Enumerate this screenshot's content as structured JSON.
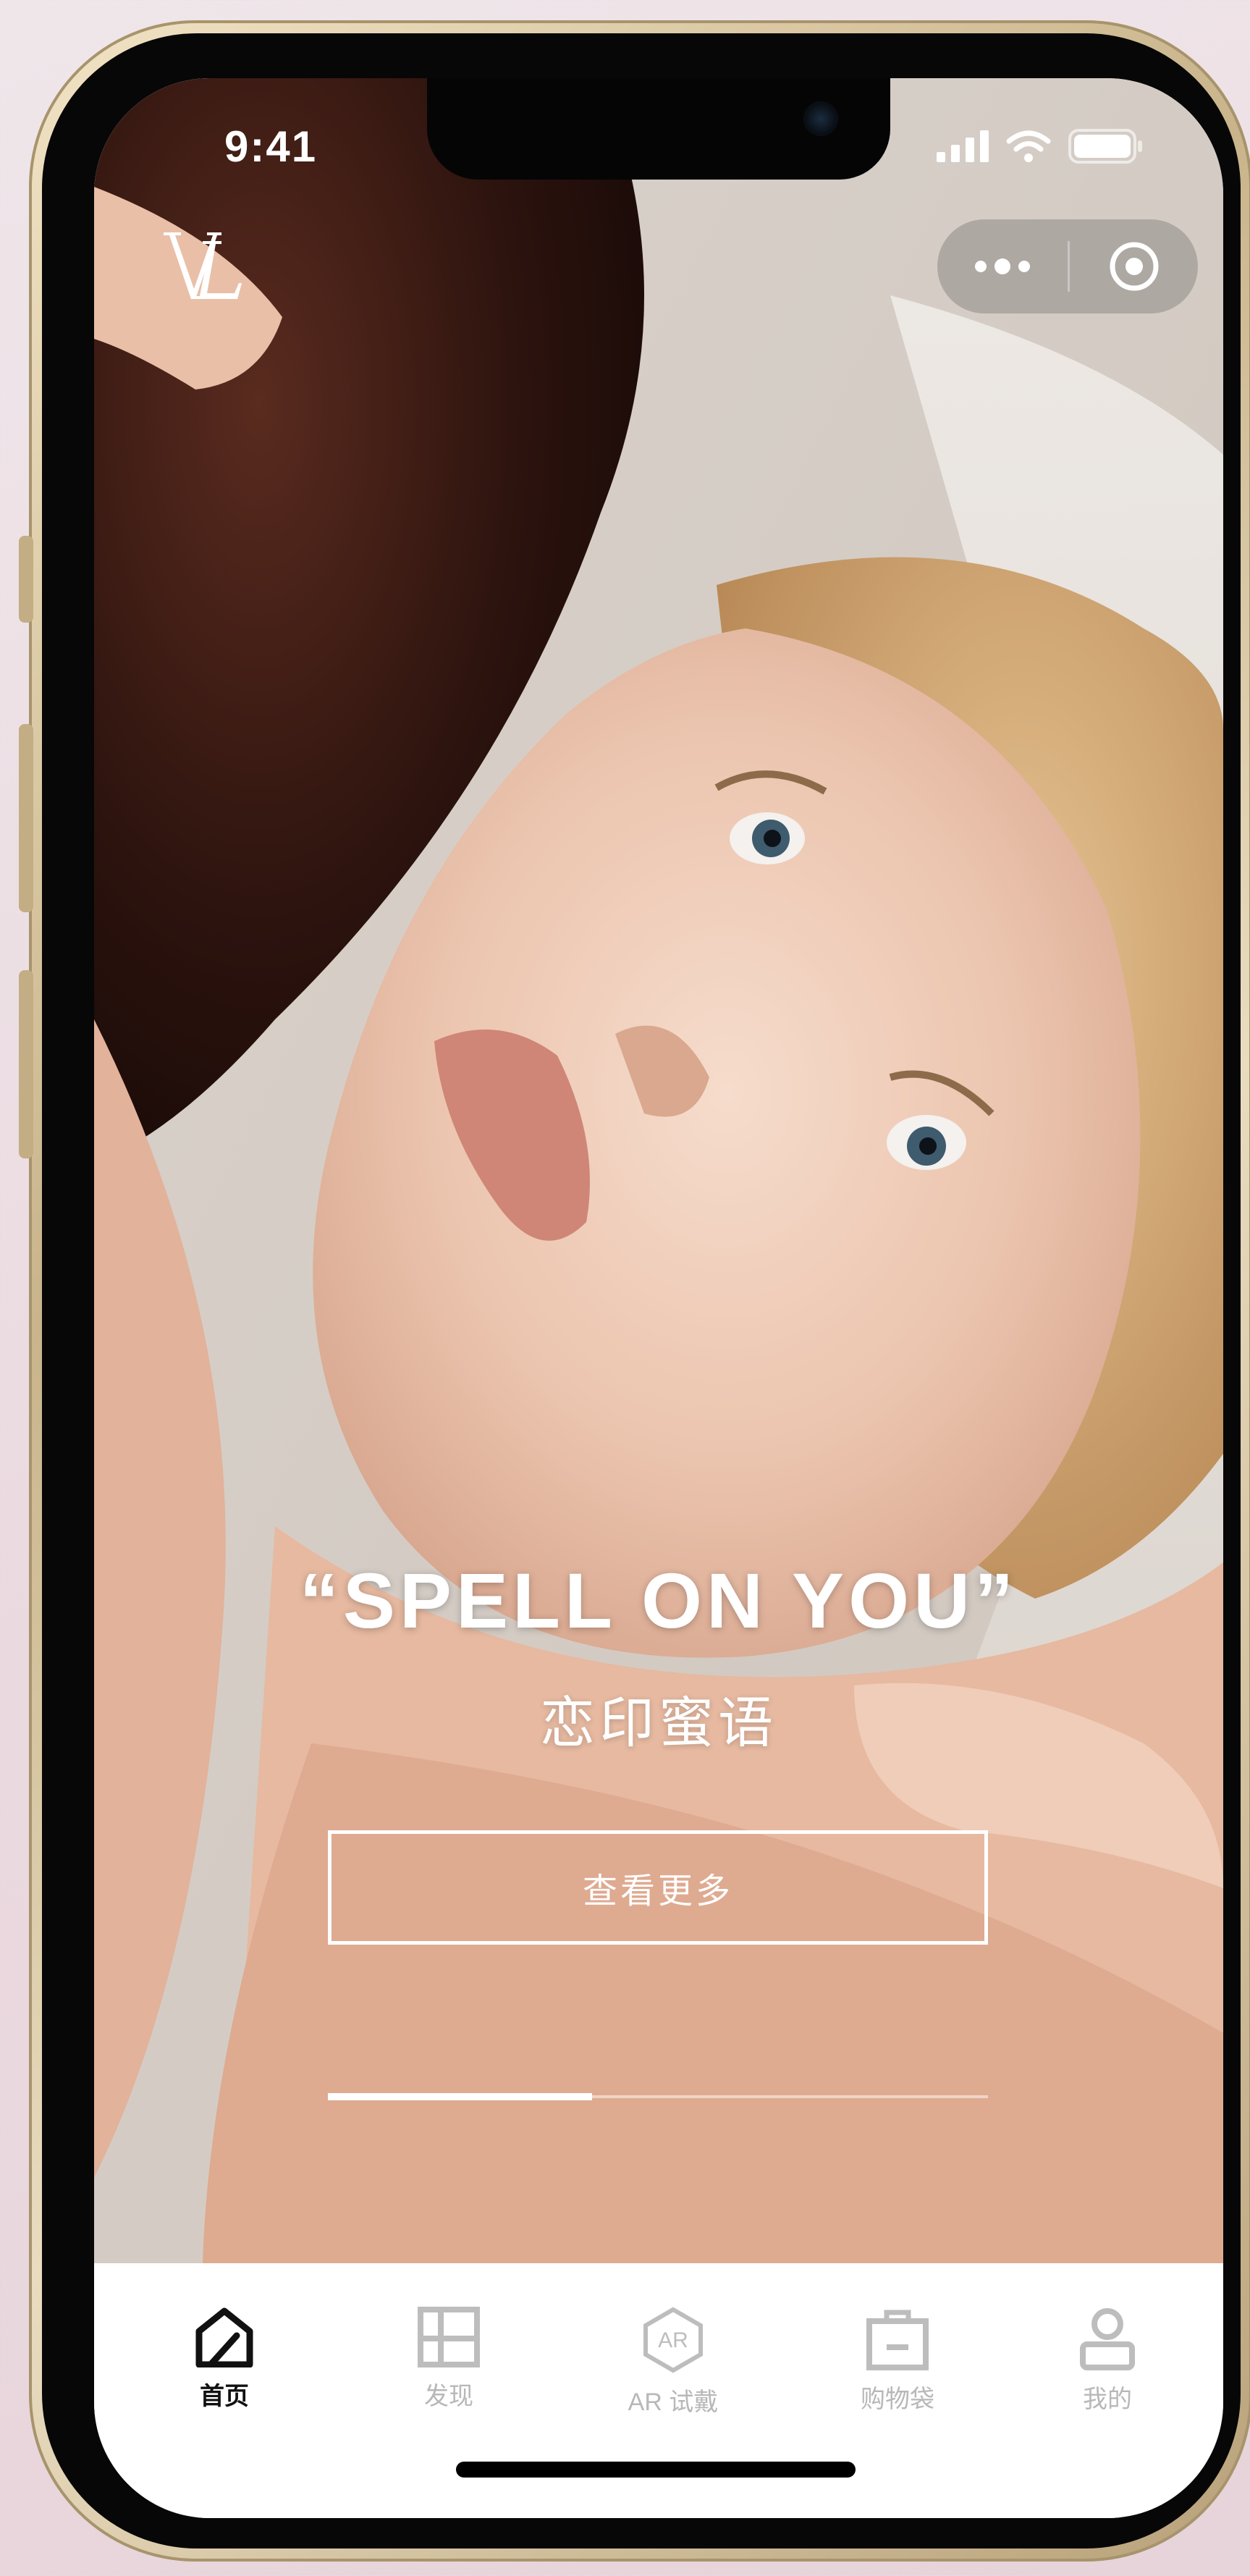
{
  "status_bar": {
    "time": "9:41",
    "signal_bars": 4,
    "battery_level": 1.0
  },
  "header": {
    "logo": "LV",
    "capsule": {
      "more_icon": "more-dots-icon",
      "close_icon": "target-close-icon"
    }
  },
  "hero": {
    "title": "“SPELL ON YOU”",
    "subtitle": "恋印蜜语",
    "button_label": "查看更多",
    "carousel_progress": 0.4
  },
  "tab_bar": {
    "items": [
      {
        "label": "首页",
        "icon": "home-icon",
        "active": true
      },
      {
        "label": "发现",
        "icon": "discover-grid-icon",
        "active": false
      },
      {
        "label": "AR 试戴",
        "icon": "ar-hexagon-icon",
        "active": false
      },
      {
        "label": "购物袋",
        "icon": "shopping-bag-icon",
        "active": false
      },
      {
        "label": "我的",
        "icon": "profile-icon",
        "active": false
      }
    ]
  },
  "colors": {
    "tab_active": "#111111",
    "tab_inactive": "#b8b8b8",
    "frame_gold": "#c9b48b"
  }
}
